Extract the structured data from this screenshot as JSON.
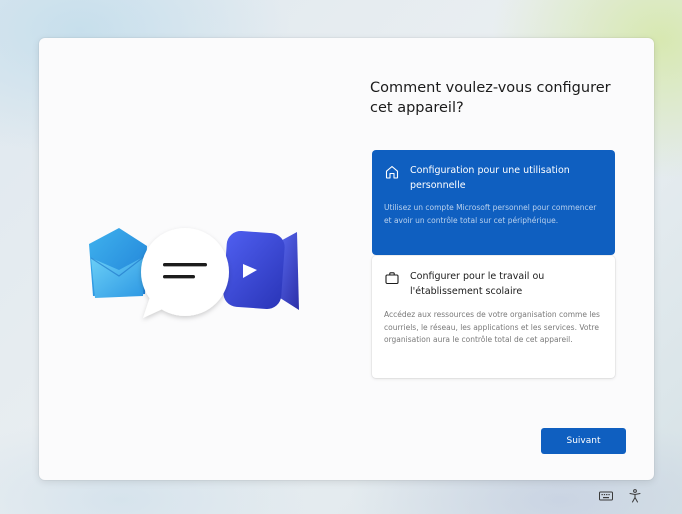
{
  "page": {
    "title": "Comment voulez-vous configurer cet appareil?"
  },
  "options": [
    {
      "icon": "home-icon",
      "title": "Configuration pour une utilisation personnelle",
      "description": "Utilisez un compte Microsoft personnel pour commencer et avoir un contrôle total sur cet périphérique.",
      "selected": true
    },
    {
      "icon": "briefcase-icon",
      "title": "Configurer pour le travail ou l'établissement scolaire",
      "description": "Accédez aux ressources de votre organisation comme les courriels, le réseau, les applications et les services. Votre organisation aura le contrôle total de cet appareil.",
      "selected": false
    }
  ],
  "footer": {
    "next_label": "Suivant"
  },
  "taskbar": {
    "icons": [
      "keyboard-icon",
      "accessibility-icon"
    ]
  },
  "colors": {
    "accent": "#0f5fc0",
    "card_background": "#fbfbfc",
    "text_primary": "#1b1b1b"
  },
  "illustration": {
    "icons": [
      "mail-icon",
      "chat-bubble-icon",
      "video-camera-icon"
    ]
  }
}
